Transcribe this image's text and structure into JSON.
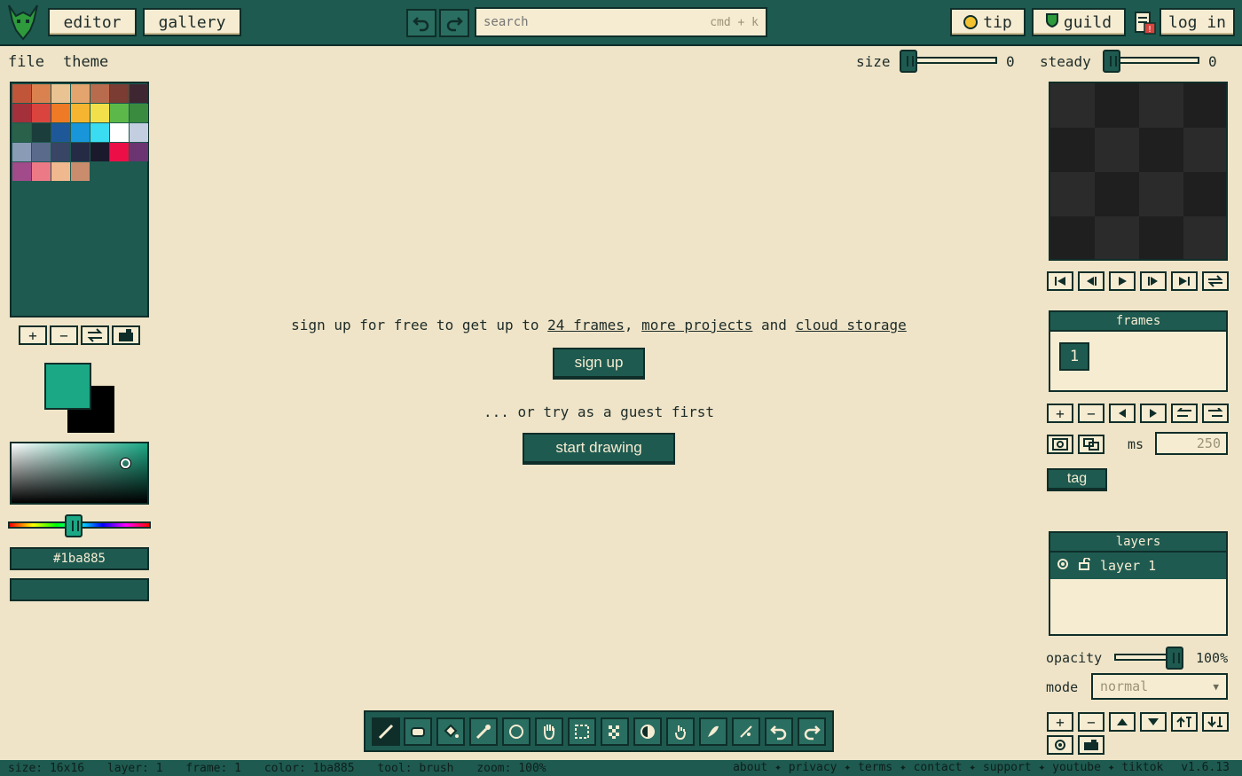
{
  "topbar": {
    "editor_label": "editor",
    "gallery_label": "gallery",
    "search_placeholder": "search",
    "search_shortcut": "cmd + k",
    "tip_label": "tip",
    "guild_label": "guild",
    "login_label": "log in"
  },
  "menu": {
    "file": "file",
    "theme": "theme"
  },
  "brush": {
    "size_label": "size",
    "size_value": "0",
    "steady_label": "steady",
    "steady_value": "0"
  },
  "palette": {
    "colors": [
      "#c0553a",
      "#d9824f",
      "#e9c492",
      "#e3a46e",
      "#b86c4d",
      "#7a3c33",
      "#3f2732",
      "#a3303b",
      "#d9443f",
      "#ee7a26",
      "#f6b530",
      "#f2e04a",
      "#5cb949",
      "#3a8b3f",
      "#29614a",
      "#1b3d3c",
      "#1f5898",
      "#1996d9",
      "#39dcf0",
      "#ffffff",
      "#c3cee0",
      "#8a9bb5",
      "#5a6a8b",
      "#384564",
      "#262b45",
      "#1b1a2c",
      "#ec0f47",
      "#6a3570",
      "#a14b8a",
      "#ec7a86",
      "#f0b88f",
      "#c98d6e"
    ]
  },
  "color": {
    "primary": "#1ba885",
    "secondary": "#000000",
    "hex_text": "#1ba885"
  },
  "center": {
    "promo_prefix": "sign up for free to get up to",
    "promo_link1": "24 frames",
    "promo_sep": ",",
    "promo_link2": "more projects",
    "promo_and": "and",
    "promo_link3": "cloud storage",
    "signup_label": "sign up",
    "guest_text": "... or try as a guest first",
    "start_label": "start drawing"
  },
  "frames": {
    "title": "frames",
    "items": [
      "1"
    ],
    "ms_label": "ms",
    "ms_value": "250",
    "tag_label": "tag"
  },
  "layers": {
    "title": "layers",
    "items": [
      "layer 1"
    ],
    "opacity_label": "opacity",
    "opacity_value": "100%",
    "opacity_level": 1.0,
    "mode_label": "mode",
    "mode_value": "normal"
  },
  "status": {
    "size": "size: 16x16",
    "layer": "layer: 1",
    "frame": "frame: 1",
    "color": "color: 1ba885",
    "tool": "tool: brush",
    "zoom": "zoom: 100%",
    "links": "about ✦ privacy ✦ terms ✦ contact ✦ support ✦ youtube ✦ tiktok",
    "version": "v1.6.13"
  },
  "theme_colors": {
    "accent": "#1e5a50",
    "bg": "#efe4c8",
    "panel": "#f6ecd2",
    "dark": "#0f2e29"
  }
}
